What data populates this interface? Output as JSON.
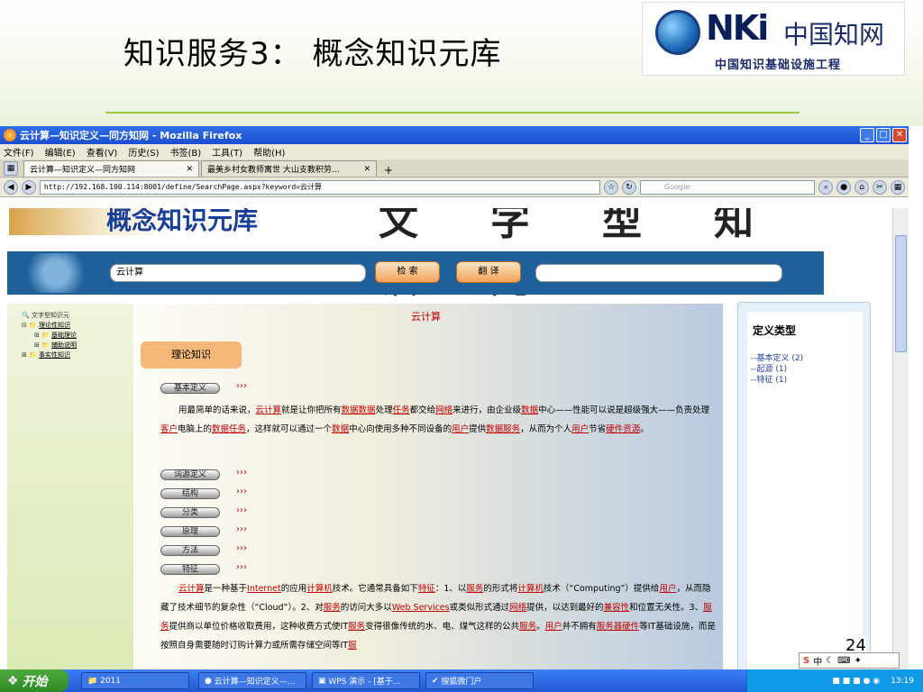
{
  "slide": {
    "title": "知识服务3：  概念知识元库",
    "page_number": "24",
    "logo": {
      "letters": "NKi",
      "name_cn": "中国知网",
      "subtitle": "中国知识基础设施工程"
    }
  },
  "browser": {
    "window_title": "云计算—知识定义—同方知网 - Mozilla Firefox",
    "menu": [
      "文件(F)",
      "编辑(E)",
      "查看(V)",
      "历史(S)",
      "书签(B)",
      "工具(T)",
      "帮助(H)"
    ],
    "tabs": [
      {
        "label": "云计算—知识定义—同方知网"
      },
      {
        "label": "最美乡村女教师寓世 大山支教积劳…"
      }
    ],
    "url": "http://192.168.100.114:8001/define/SearchPage.aspx?keyword=云计算",
    "search_placeholder": "Google"
  },
  "page": {
    "banner_title": "概念知识元库",
    "banner_big": "文字型知识元",
    "keyword": "云计算",
    "search_button": "检 索",
    "translate_button": "翻 译",
    "tree": [
      {
        "label": "文字型知识元",
        "level": 0
      },
      {
        "label": "理论性知识",
        "level": 1
      },
      {
        "label": "基础理论",
        "level": 2
      },
      {
        "label": "辅助说明",
        "level": 2
      },
      {
        "label": "事实性知识",
        "level": 1
      }
    ],
    "main_title": "云计算",
    "tag": "理论知识",
    "sections": [
      "基本定义",
      "词源定义",
      "结构",
      "分类",
      "原理",
      "方法",
      "特征"
    ],
    "chevrons": "›››",
    "para1": {
      "t1": "用最简单的话来说，",
      "h1": "云计算",
      "t2": "就是让你把所有",
      "h2": "数据数据",
      "t3": "处理",
      "h3": "任务",
      "t4": "都交给",
      "h4": "网络",
      "t5": "来进行，由企业级",
      "h5": "数据",
      "t6": "中心——性能可以说是超级强大——负责处理",
      "h6": "客户",
      "t7": "电脑上的",
      "h7": "数据任务",
      "t8": "，这样就可以通过一个",
      "h8": "数据",
      "t9": "中心向使用多种不同设备的",
      "h9": "用户",
      "t10": "提供",
      "h10": "数据服务",
      "t11": "，从而为个人",
      "h11": "用户",
      "t12": "节省",
      "h12": "硬件资源",
      "t13": "。"
    },
    "para2": {
      "h1": "云计算",
      "t1": "是一种基于",
      "h2": "Internet",
      "t2": "的应用",
      "h3": "计算机",
      "t3": "技术。它通常具备如下",
      "h4": "特征",
      "t4": "：1、以",
      "h5": "服务",
      "t5": "的形式将",
      "h6": "计算机",
      "t6": "技术（“Computing”）提供给",
      "h7": "用户",
      "t7": "，从而隐藏了技术细节的复杂性（“Cloud”）。2、对",
      "h8": "服务",
      "t8": "的访问大多以",
      "h9": "Web Services",
      "t9": "或类似形式通过",
      "h10": "网络",
      "t10": "提供，以达到最好的",
      "h11": "兼容性",
      "t11": "和位置无关性。3、",
      "h12": "服务",
      "t12": "提供商以单位价格收取费用，这种收费方式使IT",
      "h13": "服务",
      "t13": "变得很像传统的水、电、煤气这样的公共",
      "h14": "服务",
      "t14": "。",
      "h15": "用户",
      "t15": "并不拥有",
      "h16": "服务器硬件",
      "t16": "等IT基础设施，而是按照自身需要随时订购计算力或所需存储空间等IT",
      "h17": "服"
    },
    "right_panel": {
      "title": "定义类型",
      "items": [
        "--基本定义 (2)",
        "--起源 (1)",
        "--特征 (1)"
      ]
    }
  },
  "taskbar": {
    "start": "开始",
    "items": [
      "2011",
      "云计算—知识定义—...",
      "WPS 演示 - [基于...",
      "搜狐微门户"
    ],
    "clock": "13:19"
  },
  "ime": {
    "label": "中"
  }
}
